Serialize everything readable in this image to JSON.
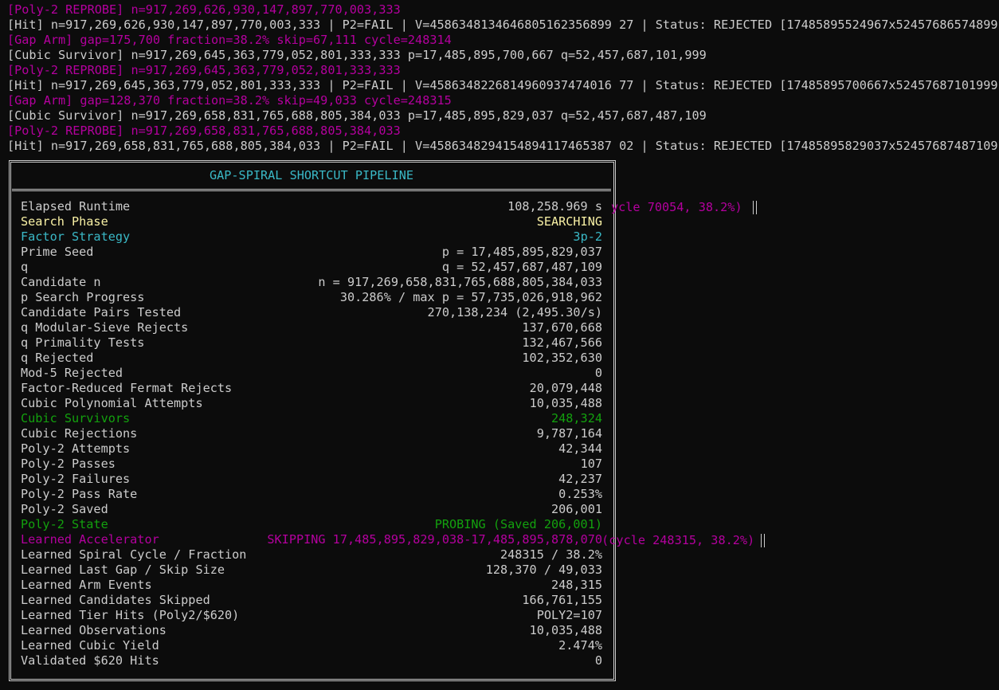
{
  "log_lines": [
    {
      "color": "magenta",
      "text": "[Poly-2 REPROBE] n=917,269,626,930,147,897,770,003,333"
    },
    {
      "color": "white",
      "text": "[Hit] n=917,269,626,930,147,897,770,003,333 | P2=FAIL | V=4586348134646805162356899 27 | Status: REJECTED [17485895524967x52457686574899]"
    },
    {
      "color": "magenta",
      "text": "[Gap Arm] gap=175,700 fraction=38.2% skip=67,111 cycle=248314"
    },
    {
      "color": "white",
      "text": "[Cubic Survivor] n=917,269,645,363,779,052,801,333,333 p=17,485,895,700,667 q=52,457,687,101,999"
    },
    {
      "color": "magenta",
      "text": "[Poly-2 REPROBE] n=917,269,645,363,779,052,801,333,333"
    },
    {
      "color": "white",
      "text": "[Hit] n=917,269,645,363,779,052,801,333,333 | P2=FAIL | V=4586348226814960937474016 77 | Status: REJECTED [17485895700667x52457687101999]"
    },
    {
      "color": "magenta",
      "text": "[Gap Arm] gap=128,370 fraction=38.2% skip=49,033 cycle=248315"
    },
    {
      "color": "white",
      "text": "[Cubic Survivor] n=917,269,658,831,765,688,805,384,033 p=17,485,895,829,037 q=52,457,687,487,109"
    },
    {
      "color": "magenta",
      "text": "[Poly-2 REPROBE] n=917,269,658,831,765,688,805,384,033"
    },
    {
      "color": "white",
      "text": "[Hit] n=917,269,658,831,765,688,805,384,033 | P2=FAIL | V=4586348294154894117465387 02 | Status: REJECTED [17485895829037x52457687487109]"
    }
  ],
  "panel": {
    "title": "GAP-SPIRAL SHORTCUT PIPELINE",
    "rows": [
      {
        "label": "Elapsed Runtime",
        "value": "108,258.969 s",
        "label_color": "white",
        "value_color": "white"
      },
      {
        "label": "Search Phase",
        "value": "SEARCHING",
        "label_color": "yellow",
        "value_color": "yellow"
      },
      {
        "label": "Factor Strategy",
        "value": "3p-2",
        "label_color": "cyan",
        "value_color": "cyan"
      },
      {
        "label": "Prime Seed",
        "value": "p = 17,485,895,829,037",
        "label_color": "white",
        "value_color": "white"
      },
      {
        "label": "q",
        "value": "q = 52,457,687,487,109",
        "label_color": "white",
        "value_color": "white"
      },
      {
        "label": "Candidate n",
        "value": "n = 917,269,658,831,765,688,805,384,033",
        "label_color": "white",
        "value_color": "white"
      },
      {
        "label": "p Search Progress",
        "value": "30.286% / max p = 57,735,026,918,962",
        "label_color": "white",
        "value_color": "white"
      },
      {
        "label": "Candidate Pairs Tested",
        "value": "270,138,234 (2,495.30/s)",
        "label_color": "white",
        "value_color": "white"
      },
      {
        "label": "q Modular-Sieve Rejects",
        "value": "137,670,668",
        "label_color": "white",
        "value_color": "white"
      },
      {
        "label": "q Primality Tests",
        "value": "132,467,566",
        "label_color": "white",
        "value_color": "white"
      },
      {
        "label": "q Rejected",
        "value": "102,352,630",
        "label_color": "white",
        "value_color": "white"
      },
      {
        "label": "Mod-5 Rejected",
        "value": "0",
        "label_color": "white",
        "value_color": "white"
      },
      {
        "label": "Factor-Reduced Fermat Rejects",
        "value": "20,079,448",
        "label_color": "white",
        "value_color": "white"
      },
      {
        "label": "Cubic Polynomial Attempts",
        "value": "10,035,488",
        "label_color": "white",
        "value_color": "white"
      },
      {
        "label": "Cubic Survivors",
        "value": "248,324",
        "label_color": "green",
        "value_color": "green"
      },
      {
        "label": "Cubic Rejections",
        "value": "9,787,164",
        "label_color": "white",
        "value_color": "white"
      },
      {
        "label": "Poly-2 Attempts",
        "value": "42,344",
        "label_color": "white",
        "value_color": "white"
      },
      {
        "label": "Poly-2 Passes",
        "value": "107",
        "label_color": "white",
        "value_color": "white"
      },
      {
        "label": "Poly-2 Failures",
        "value": "42,237",
        "label_color": "white",
        "value_color": "white"
      },
      {
        "label": "Poly-2 Pass Rate",
        "value": "0.253%",
        "label_color": "white",
        "value_color": "white"
      },
      {
        "label": "Poly-2 Saved",
        "value": "206,001",
        "label_color": "white",
        "value_color": "white"
      },
      {
        "label": "Poly-2 State",
        "value": "PROBING (Saved 206,001)",
        "label_color": "green",
        "value_color": "green"
      },
      {
        "label": "Learned Accelerator",
        "value": "SKIPPING 17,485,895,829,038-17,485,895,878,070",
        "label_color": "magenta",
        "value_color": "magenta"
      },
      {
        "label": "Learned Spiral Cycle / Fraction",
        "value": "248315 / 38.2%",
        "label_color": "white",
        "value_color": "white"
      },
      {
        "label": "Learned Last Gap / Skip Size",
        "value": "128,370 / 49,033",
        "label_color": "white",
        "value_color": "white"
      },
      {
        "label": "Learned Arm Events",
        "value": "248,315",
        "label_color": "white",
        "value_color": "white"
      },
      {
        "label": "Learned Candidates Skipped",
        "value": "166,761,155",
        "label_color": "white",
        "value_color": "white"
      },
      {
        "label": "Learned Tier Hits (Poly2/$620)",
        "value": "POLY2=107",
        "label_color": "white",
        "value_color": "white"
      },
      {
        "label": "Learned Observations",
        "value": "10,035,488",
        "label_color": "white",
        "value_color": "white"
      },
      {
        "label": "Learned Cubic Yield",
        "value": "2.474%",
        "label_color": "white",
        "value_color": "white"
      },
      {
        "label": "Validated $620 Hits",
        "value": "0",
        "label_color": "white",
        "value_color": "white"
      }
    ],
    "overflow_runtime": "ycle 70054, 38.2%)",
    "overflow_accelerator": " (cycle 248315, 38.2%)"
  }
}
